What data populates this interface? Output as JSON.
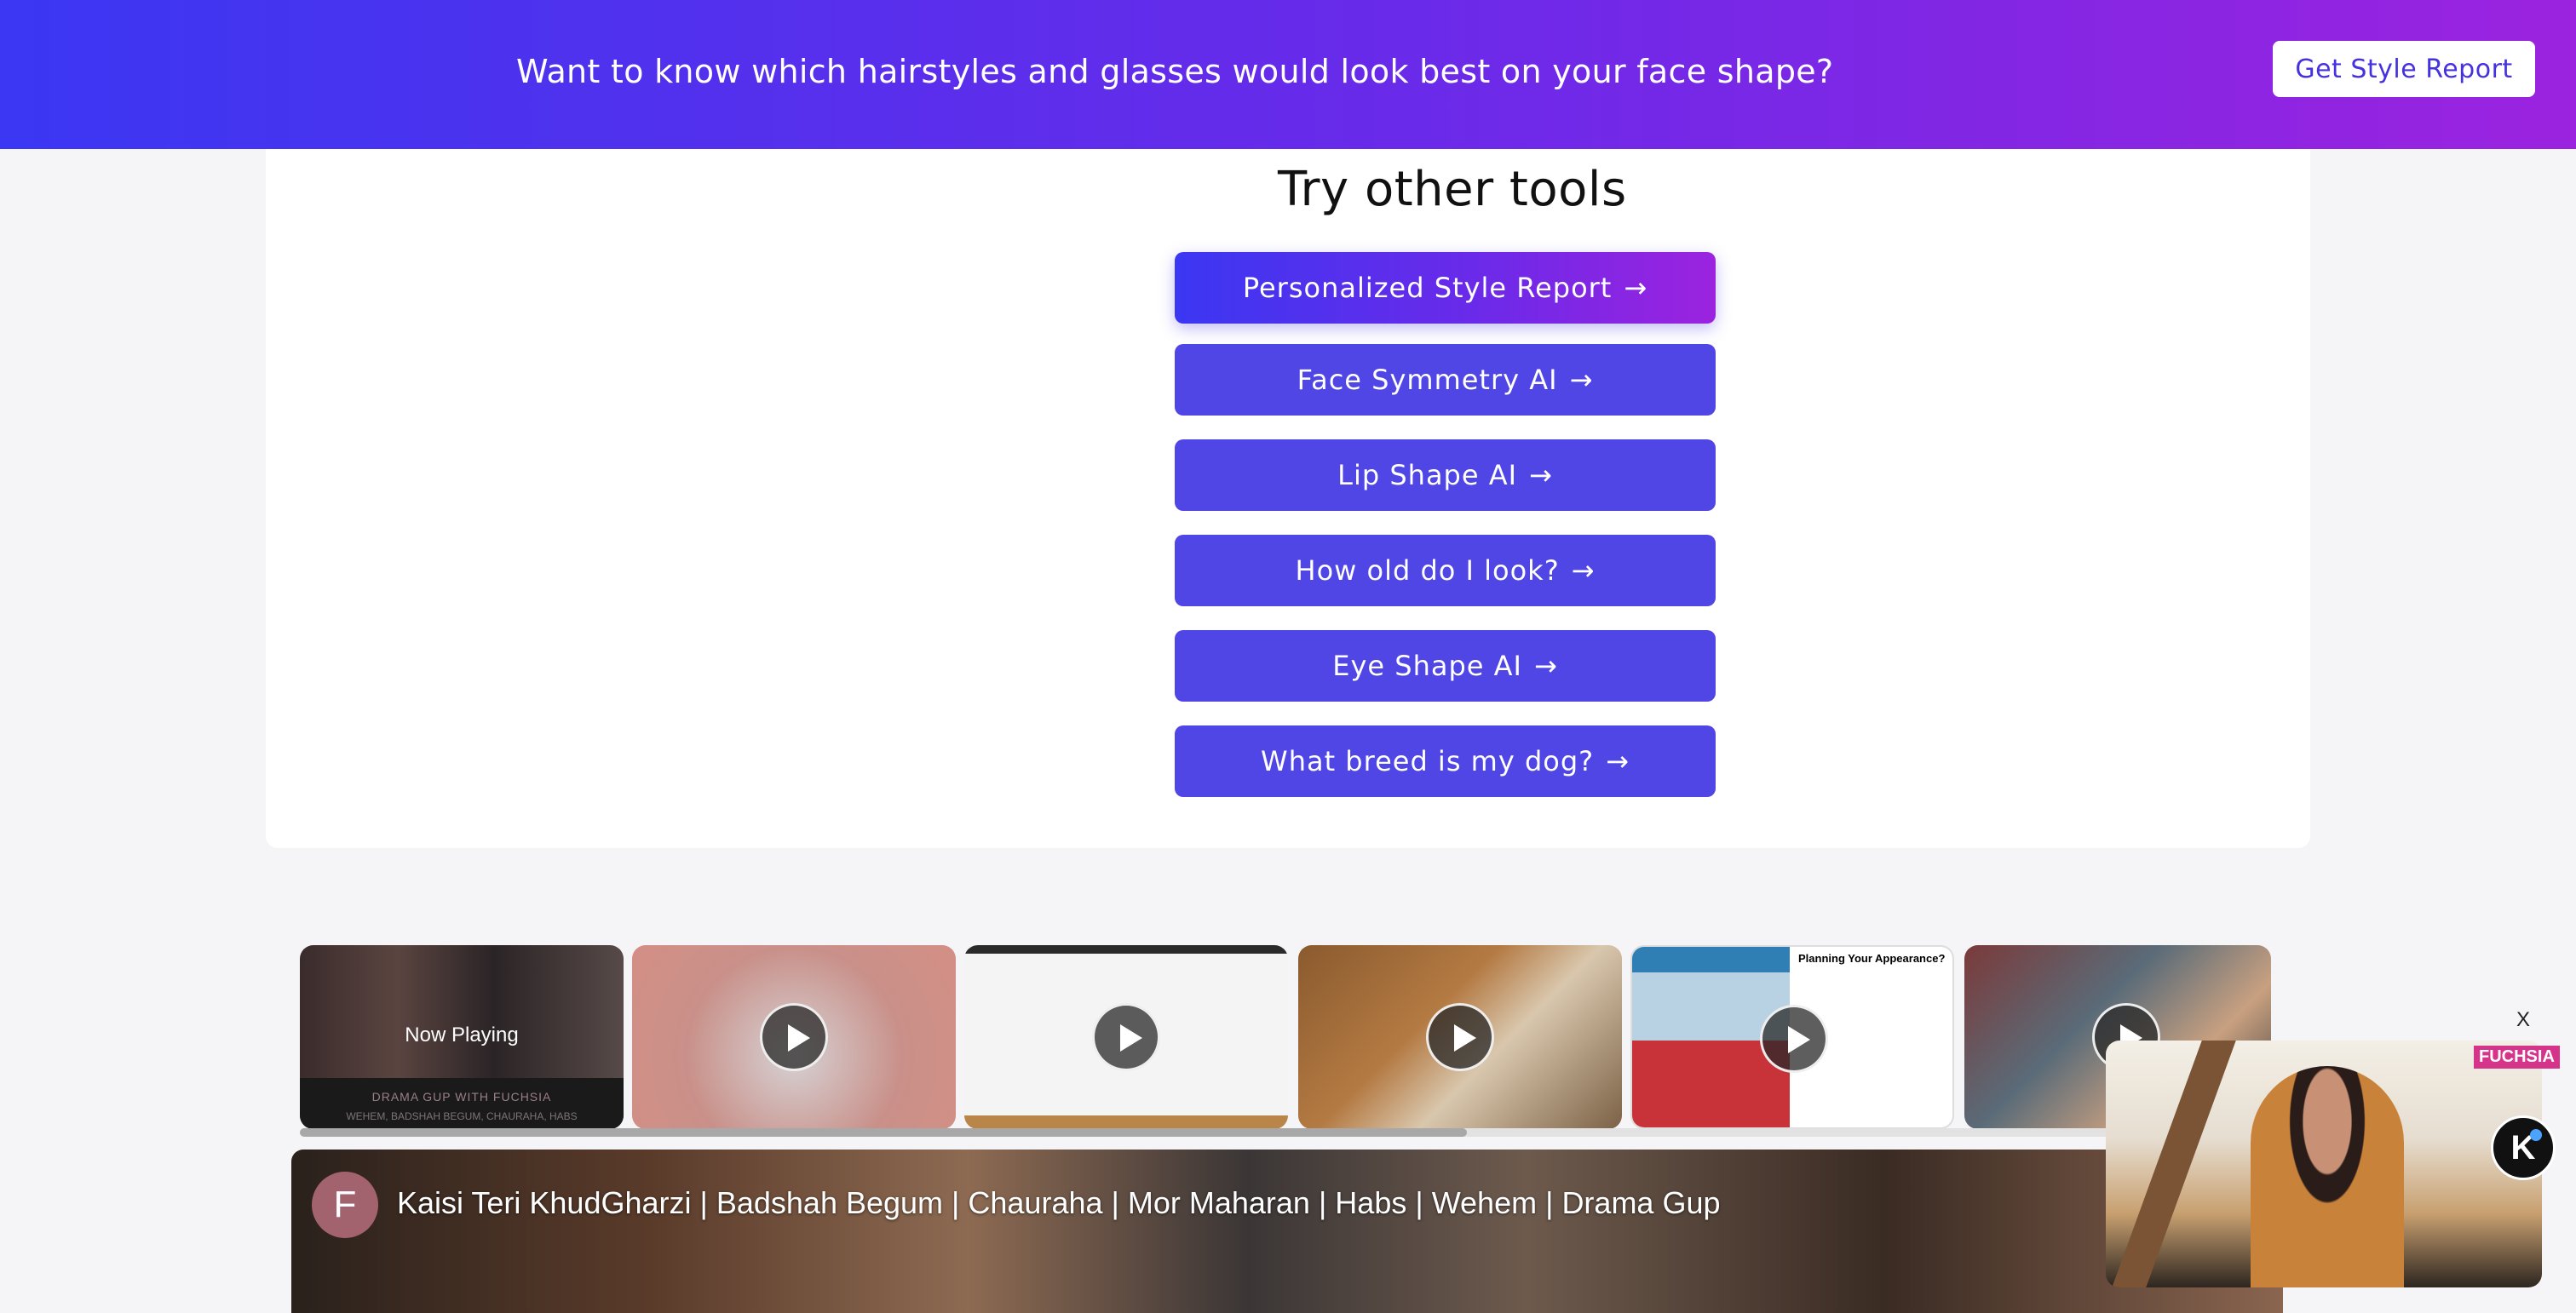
{
  "banner": {
    "text": "Want to know which hairstyles and glasses would look best on your face shape?",
    "cta_label": "Get Style Report"
  },
  "tools": {
    "title": "Try other tools",
    "arrow": "→",
    "buttons": [
      {
        "label": "Personalized Style Report",
        "featured": true
      },
      {
        "label": "Face Symmetry AI"
      },
      {
        "label": "Lip Shape AI"
      },
      {
        "label": "How old do I look?"
      },
      {
        "label": "Eye Shape AI"
      },
      {
        "label": "What breed is my dog?"
      }
    ]
  },
  "carousel": {
    "now_playing": "Now Playing",
    "thumb1_label": "DRAMA GUP WITH FUCHSIA",
    "thumb1_sub": "WEHEM, BADSHAH BEGUM, CHAURAHA, HABS",
    "thumb5_title": "Planning Your Appearance?"
  },
  "player": {
    "avatar_letter": "F",
    "title": "Kaisi Teri KhudGharzi | Badshah Begum | Chauraha | Mor Maharan | Habs | Wehem | Drama Gup"
  },
  "mini_player": {
    "close_label": "X",
    "brand": "FUCHSIA",
    "logo_letter": "K"
  },
  "colors": {
    "brand_gradient_start": "#3b37f2",
    "brand_gradient_end": "#9b23df",
    "tool_button": "#4f46e5"
  }
}
